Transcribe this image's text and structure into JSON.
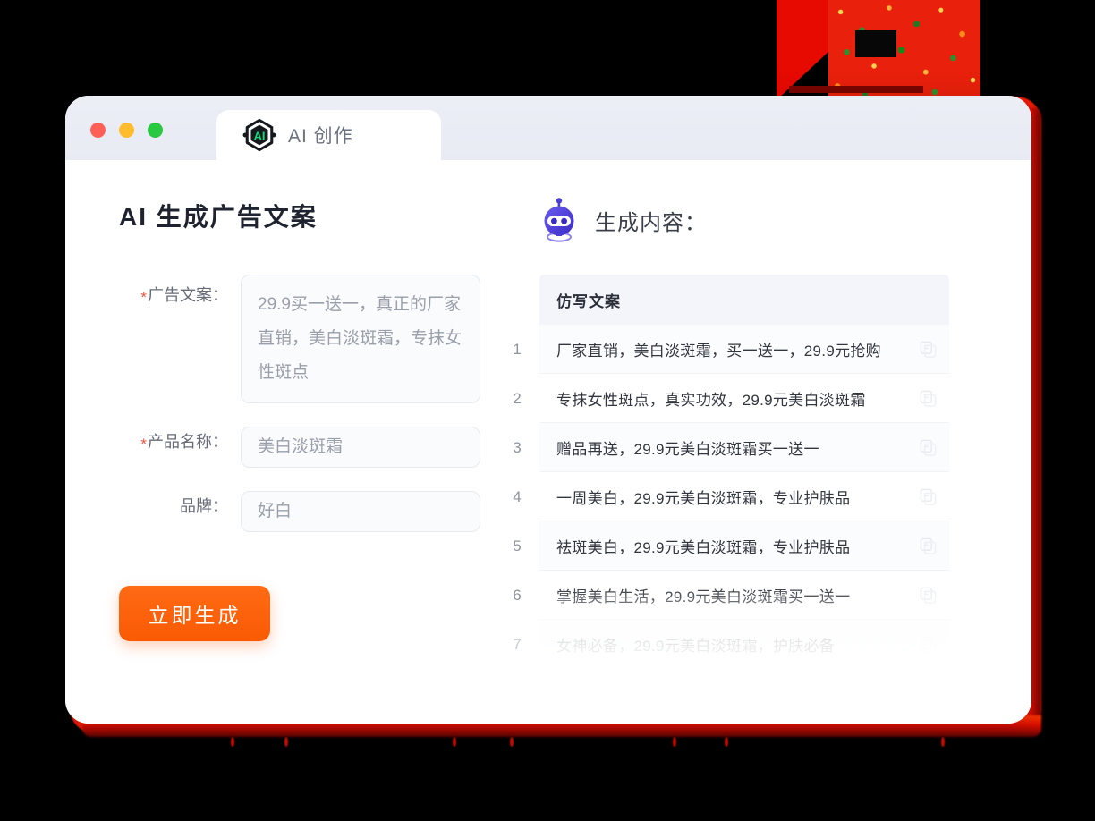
{
  "window": {
    "traffic_lights": [
      {
        "name": "close",
        "color": "#ff5f57"
      },
      {
        "name": "minimize",
        "color": "#febc2e"
      },
      {
        "name": "maximize",
        "color": "#28c840"
      }
    ],
    "tab": {
      "label": "AI 创作",
      "logo_text": "AI",
      "logo_icon": "ai-hexagon-logo-icon"
    }
  },
  "left": {
    "page_title": "AI 生成广告文案",
    "fields": [
      {
        "label": "广告文案：",
        "required": true,
        "type": "textarea",
        "value": "29.9买一送一，真正的厂家直销，美白淡斑霜，专抹女性斑点"
      },
      {
        "label": "产品名称：",
        "required": true,
        "type": "text",
        "value": "美白淡斑霜"
      },
      {
        "label": "品牌：",
        "required": false,
        "type": "text",
        "value": "好白"
      }
    ],
    "submit_button": "立即生成"
  },
  "right": {
    "icon": "robot-head-icon",
    "title": "生成内容：",
    "table": {
      "header": "仿写文案",
      "row_numbers": [
        "1",
        "2",
        "3",
        "4",
        "5",
        "6",
        "7"
      ],
      "rows": [
        {
          "num": "1",
          "text": "厂家直销，美白淡斑霜，买一送一，29.9元抢购",
          "copy_icon": "copy-icon"
        },
        {
          "num": "2",
          "text": "专抹女性斑点，真实功效，29.9元美白淡斑霜",
          "copy_icon": "copy-icon"
        },
        {
          "num": "3",
          "text": "赠品再送，29.9元美白淡斑霜买一送一",
          "copy_icon": "copy-icon"
        },
        {
          "num": "4",
          "text": "一周美白，29.9元美白淡斑霜，专业护肤品",
          "copy_icon": "copy-icon"
        },
        {
          "num": "5",
          "text": "祛斑美白，29.9元美白淡斑霜，专业护肤品",
          "copy_icon": "copy-icon"
        },
        {
          "num": "6",
          "text": "掌握美白生活，29.9元美白淡斑霜买一送一",
          "copy_icon": "copy-icon"
        },
        {
          "num": "7",
          "text": "女神必备，29.9元美白淡斑霜，护肤必备",
          "copy_icon": "copy-icon"
        }
      ]
    }
  },
  "colors": {
    "accent_orange": "#fa5a04",
    "required_star": "#f0503a",
    "logo_green": "#19d97c",
    "robot_purple": "#4a3fd4",
    "header_bg": "#f3f5fa",
    "titlebar_bg": "#eceef6",
    "halo_red": "#ef1b06"
  }
}
